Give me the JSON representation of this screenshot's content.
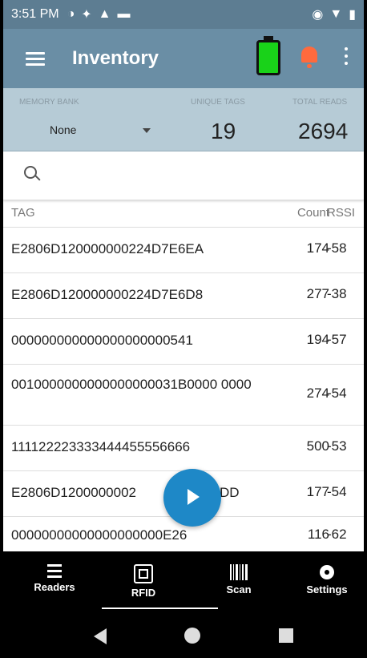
{
  "status": {
    "time": "3:51 PM",
    "icons": [
      "data-saver-icon",
      "settings-gear-icon",
      "warning-icon",
      "cast-icon"
    ],
    "right_icons": [
      "sync-icon",
      "wifi-icon",
      "battery-status-icon"
    ]
  },
  "appbar": {
    "title": "Inventory",
    "battery_color": "#19d219",
    "bell_color": "#ff6a3d"
  },
  "stats": {
    "memory_bank_label": "MEMORY BANK",
    "memory_bank_value": "None",
    "unique_tags_label": "UNIQUE TAGS",
    "unique_tags_value": "19",
    "total_reads_label": "TOTAL READS",
    "total_reads_value": "2694"
  },
  "table": {
    "headers": {
      "tag": "TAG",
      "count": "Count",
      "rssi": "RSSI"
    },
    "rows": [
      {
        "tag": "E2806D120000000224D7E6EA",
        "count": "174",
        "rssi": "-58"
      },
      {
        "tag": "E2806D120000000224D7E6D8",
        "count": "277",
        "rssi": "-38"
      },
      {
        "tag": "000000000000000000000541",
        "count": "194",
        "rssi": "-57"
      },
      {
        "tag": "0010000000000000000031B0000 0000",
        "count": "274",
        "rssi": "-54"
      },
      {
        "tag": "111122223333444455556666",
        "count": "500",
        "rssi": "-53"
      },
      {
        "tag": "E2806D1200000002",
        "tag_tail": "DD",
        "count": "177",
        "rssi": "-54"
      },
      {
        "tag": "00000000000000000000E26",
        "count": "116",
        "rssi": "-62"
      }
    ]
  },
  "nav": {
    "readers": "Readers",
    "rfid": "RFID",
    "scan": "Scan",
    "settings": "Settings"
  },
  "colors": {
    "status_bar": "#5d7d92",
    "app_bar": "#6a8ea5",
    "stats_panel": "#b6cbd6",
    "fab": "#1e88c7"
  }
}
